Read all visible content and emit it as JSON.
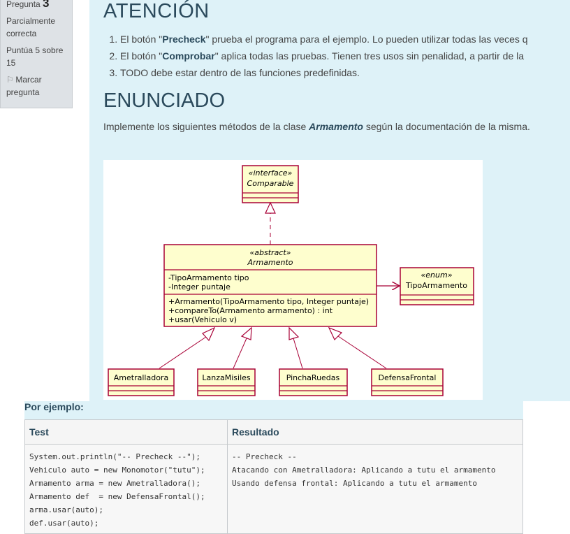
{
  "sidebar": {
    "question_label": "Pregunta",
    "question_number": "3",
    "status": "Parcialmente correcta",
    "score": "Puntúa 5 sobre 15",
    "flag_label": "Marcar pregunta"
  },
  "attention": {
    "title": "ATENCIÓN",
    "items": [
      {
        "pre": "El botón \"",
        "bold": "Precheck",
        "post": "\" prueba el programa para el ejemplo. Lo pueden utilizar todas las veces q"
      },
      {
        "pre": "El botón \"",
        "bold": "Comprobar",
        "post": "\" aplica todas las pruebas. Tienen tres usos sin penalidad, a partir de la"
      },
      {
        "pre": "TODO debe estar dentro de las funciones predefinidas.",
        "bold": "",
        "post": ""
      }
    ]
  },
  "enunciado": {
    "title": "ENUNCIADO",
    "intro_pre": "Implemente los siguientes métodos de la clase ",
    "intro_bold": "Armamento",
    "intro_post": " según la documentación de la misma."
  },
  "uml": {
    "comparable": {
      "stereotype": "«interface»",
      "name": "Comparable"
    },
    "armamento": {
      "stereotype": "«abstract»",
      "name": "Armamento",
      "attributes": [
        "-TipoArmamento tipo",
        "-Integer puntaje"
      ],
      "methods": [
        "+Armamento(TipoArmamento tipo, Integer puntaje)",
        "+compareTo(Armamento armamento) : int",
        "+usar(Vehiculo v)"
      ]
    },
    "tipo": {
      "stereotype": "«enum»",
      "name": "TipoArmamento"
    },
    "subclasses": [
      "Ametralladora",
      "LanzaMisiles",
      "PinchaRuedas",
      "DefensaFrontal"
    ]
  },
  "examples": {
    "header": "Por ejemplo:",
    "col_test": "Test",
    "col_result": "Resultado",
    "test_lines": [
      "System.out.println(\"-- Precheck --\");",
      "Vehiculo auto = new Monomotor(\"tutu\");",
      "Armamento arma = new Ametralladora();",
      "Armamento def  = new DefensaFrontal();",
      "arma.usar(auto);",
      "def.usar(auto);"
    ],
    "result_lines": [
      "-- Precheck --",
      "Atacando con Ametralladora: Aplicando a tutu el armamento",
      "Usando defensa frontal: Aplicando a tutu el armamento"
    ]
  },
  "colors": {
    "accent": "#2b4a5c",
    "content_bg": "#def2f8",
    "uml_fill": "#fefece",
    "uml_stroke": "#a80036"
  }
}
